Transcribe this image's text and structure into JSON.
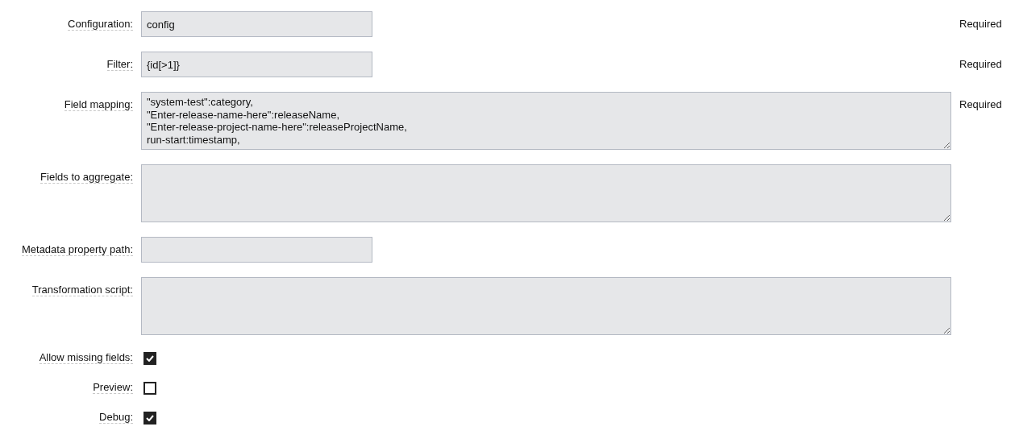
{
  "fields": [
    {
      "kind": "input",
      "label": "Configuration:",
      "value": "config",
      "required": "Required"
    },
    {
      "kind": "input",
      "label": "Filter:",
      "value": "{id[>1]}",
      "required": "Required"
    },
    {
      "kind": "textarea",
      "label": "Field mapping:",
      "lines": [
        "\"system-test\":category,",
        "\"Enter-release-name-here\":releaseName,",
        "\"Enter-release-project-name-here\":releaseProjectName,",
        "run-start:timestamp,"
      ],
      "required": "Required"
    },
    {
      "kind": "textarea",
      "label": "Fields to aggregate:"
    },
    {
      "kind": "input",
      "label": "Metadata property path:"
    },
    {
      "kind": "textarea",
      "label": "Transformation script:"
    },
    {
      "kind": "checkbox",
      "label": "Allow missing fields:",
      "checked": true
    },
    {
      "kind": "checkbox",
      "label": "Preview:",
      "checked": false
    },
    {
      "kind": "checkbox",
      "label": "Debug:",
      "checked": true
    }
  ]
}
